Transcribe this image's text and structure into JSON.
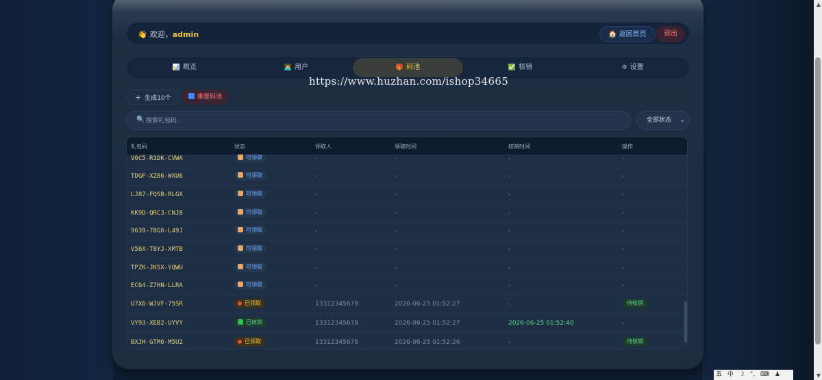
{
  "topbar": {
    "wave": "👋",
    "welcome": "欢迎，",
    "username": "admin",
    "home_label": "🏠 返回首页",
    "logout_label": "退出"
  },
  "tabs": [
    {
      "icon": "📊",
      "label": "概览"
    },
    {
      "icon": "👨‍💻",
      "label": "用户"
    },
    {
      "icon": "🎁",
      "label": "码池"
    },
    {
      "icon": "✅",
      "label": "核销"
    },
    {
      "icon": "⚙",
      "label": "设置"
    }
  ],
  "watermark": "https://www.huzhan.com/ishop34665",
  "actions": {
    "generate_label": "生成10个",
    "generate_icon": "+",
    "reset_label": "重置码池"
  },
  "search": {
    "placeholder": "搜索礼包码...",
    "value": "",
    "icon": "🔍"
  },
  "filter": {
    "selected": "全部状态",
    "chevron": "⌄"
  },
  "table": {
    "headers": [
      "礼包码",
      "状态",
      "领取人",
      "领取时间",
      "核销时间",
      "操作"
    ],
    "rows": [
      {
        "code": "V6C5-R3DK-CVWA",
        "status": "可领取",
        "status_type": "avail",
        "claimer": "-",
        "claim_time": "-",
        "verify_time": "-",
        "action": "-"
      },
      {
        "code": "TDGF-XZ86-WXU6",
        "status": "可领取",
        "status_type": "avail",
        "claimer": "-",
        "claim_time": "-",
        "verify_time": "-",
        "action": "-"
      },
      {
        "code": "LJ87-FQSB-RLGX",
        "status": "可领取",
        "status_type": "avail",
        "claimer": "-",
        "claim_time": "-",
        "verify_time": "-",
        "action": "-"
      },
      {
        "code": "KK9D-QRC3-CNJ8",
        "status": "可领取",
        "status_type": "avail",
        "claimer": "-",
        "claim_time": "-",
        "verify_time": "-",
        "action": "-"
      },
      {
        "code": "9639-78G6-L49J",
        "status": "可领取",
        "status_type": "avail",
        "claimer": "-",
        "claim_time": "-",
        "verify_time": "-",
        "action": "-"
      },
      {
        "code": "V56X-T8YJ-XMTB",
        "status": "可领取",
        "status_type": "avail",
        "claimer": "-",
        "claim_time": "-",
        "verify_time": "-",
        "action": "-"
      },
      {
        "code": "TPZK-JKSX-YQWU",
        "status": "可领取",
        "status_type": "avail",
        "claimer": "-",
        "claim_time": "-",
        "verify_time": "-",
        "action": "-"
      },
      {
        "code": "EC64-Z7HN-LLRA",
        "status": "可领取",
        "status_type": "avail",
        "claimer": "-",
        "claim_time": "-",
        "verify_time": "-",
        "action": "-"
      },
      {
        "code": "U7X6-WJVF-75SR",
        "status": "已领取",
        "status_type": "claimed",
        "claimer": "13312345678",
        "claim_time": "2026-06-25 01:52:27",
        "verify_time": "-",
        "action": "待核销"
      },
      {
        "code": "VY93-XEB2-UYVY",
        "status": "已核销",
        "status_type": "used",
        "claimer": "13312345678",
        "claim_time": "2026-06-25 01:52:27",
        "verify_time": "2026-06-25 01:52:40",
        "action": "-"
      },
      {
        "code": "BXJH-GTM6-M5U2",
        "status": "已领取",
        "status_type": "claimed",
        "claimer": "13312345678",
        "claim_time": "2026-06-25 01:52:26",
        "verify_time": "-",
        "action": "待核销"
      }
    ]
  },
  "taskbar": [
    "五",
    "中",
    "☽",
    "°,",
    "⌨",
    "♟",
    "🔧"
  ],
  "colors": {
    "accent_gold": "#f3c63f",
    "danger": "#ff6b6b",
    "success": "#5fd68a",
    "link_blue": "#86b8ff"
  }
}
